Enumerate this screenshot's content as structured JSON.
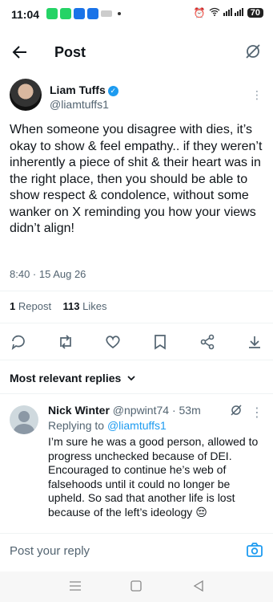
{
  "status_bar": {
    "time": "11:04",
    "battery": "70"
  },
  "header": {
    "title": "Post"
  },
  "author": {
    "name": "Liam Tuffs",
    "handle": "@liamtuffs1"
  },
  "tweet": {
    "text": "When someone you disagree with dies, it’s okay to show & feel empathy.. if they weren’t inherently a piece of shit & their heart was in the right place, then you should be able to show respect & condolence, without some wanker on X reminding you how your views didn’t align!",
    "timestamp": "8:40 · 15 Aug 26"
  },
  "stats": {
    "reposts": "1",
    "reposts_label": "Repost",
    "likes": "113",
    "likes_label": "Likes"
  },
  "sort_label": "Most relevant replies",
  "reply": {
    "name": "Nick Winter",
    "handle": "@npwint74",
    "age": "53m",
    "replying_label": "Replying to",
    "replying_to": "@liamtuffs1",
    "text": "I’m sure he was a good person, allowed to progress unchecked because of DEI. Encouraged to continue he’s web of falsehoods until it could no longer be upheld. So sad that another life is lost because of the left’s ideology 😔"
  },
  "composer": {
    "placeholder": "Post your reply"
  },
  "colors": {
    "accent": "#1d9bf0",
    "text": "#0f1419",
    "muted": "#536471"
  },
  "icons": [
    "back-arrow-icon",
    "grok-icon",
    "verified-icon",
    "more-icon",
    "reply-icon",
    "repost-icon",
    "like-icon",
    "bookmark-icon",
    "share-icon",
    "download-icon",
    "camera-icon"
  ]
}
